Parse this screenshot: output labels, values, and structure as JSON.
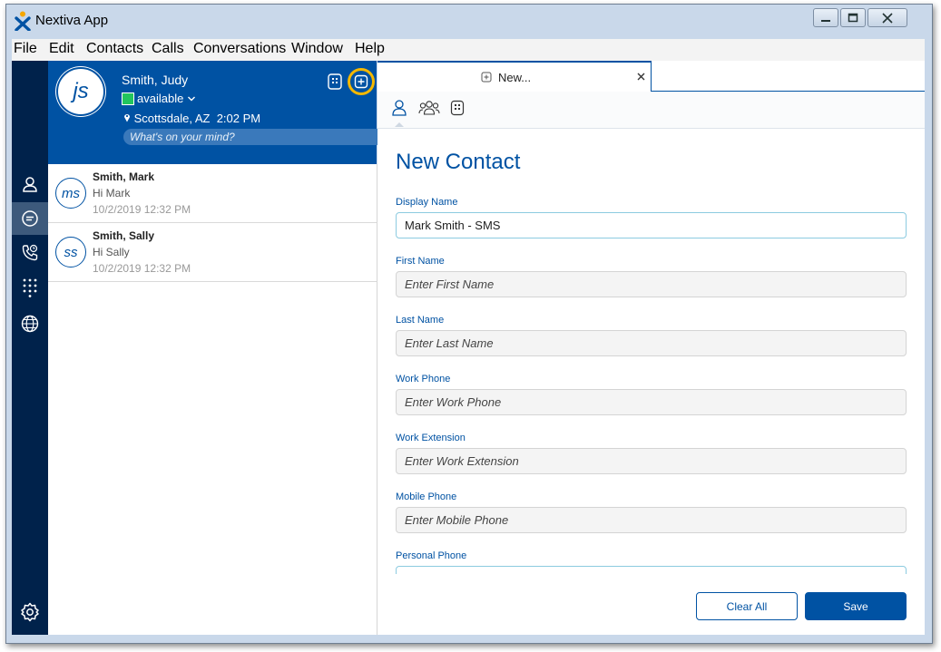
{
  "window": {
    "title": "Nextiva App",
    "controls": {
      "minimize": "—",
      "maximize": "□",
      "close": "✕"
    }
  },
  "menu": [
    "File",
    "Edit",
    "Contacts",
    "Calls",
    "Conversations",
    "Window",
    "Help"
  ],
  "profile": {
    "initials": "js",
    "name": "Smith, Judy",
    "status": "available",
    "location": "Scottsdale, AZ",
    "time": "2:02 PM",
    "mind_placeholder": "What's on your mind?"
  },
  "conversations": [
    {
      "initials": "ms",
      "name": "Smith, Mark",
      "message": "Hi Mark",
      "time": "10/2/2019 12:32 PM"
    },
    {
      "initials": "ss",
      "name": "Smith, Sally",
      "message": "Hi Sally",
      "time": "10/2/2019 12:32 PM"
    }
  ],
  "tab": {
    "label": "New..."
  },
  "form": {
    "title": "New Contact",
    "fields": [
      {
        "label": "Display Name",
        "value": "Mark Smith - SMS",
        "placeholder": ""
      },
      {
        "label": "First Name",
        "value": "",
        "placeholder": "Enter First Name"
      },
      {
        "label": "Last Name",
        "value": "",
        "placeholder": "Enter Last Name"
      },
      {
        "label": "Work Phone",
        "value": "",
        "placeholder": "Enter Work Phone"
      },
      {
        "label": "Work Extension",
        "value": "",
        "placeholder": "Enter Work Extension"
      },
      {
        "label": "Mobile Phone",
        "value": "",
        "placeholder": "Enter Mobile Phone"
      },
      {
        "label": "Personal Phone",
        "value": "",
        "placeholder": ""
      }
    ],
    "clear_label": "Clear All",
    "save_label": "Save"
  },
  "colors": {
    "brand": "#0052a3",
    "rail": "#00224b",
    "status_available": "#22c55e",
    "highlight_ring": "#f5b800"
  }
}
